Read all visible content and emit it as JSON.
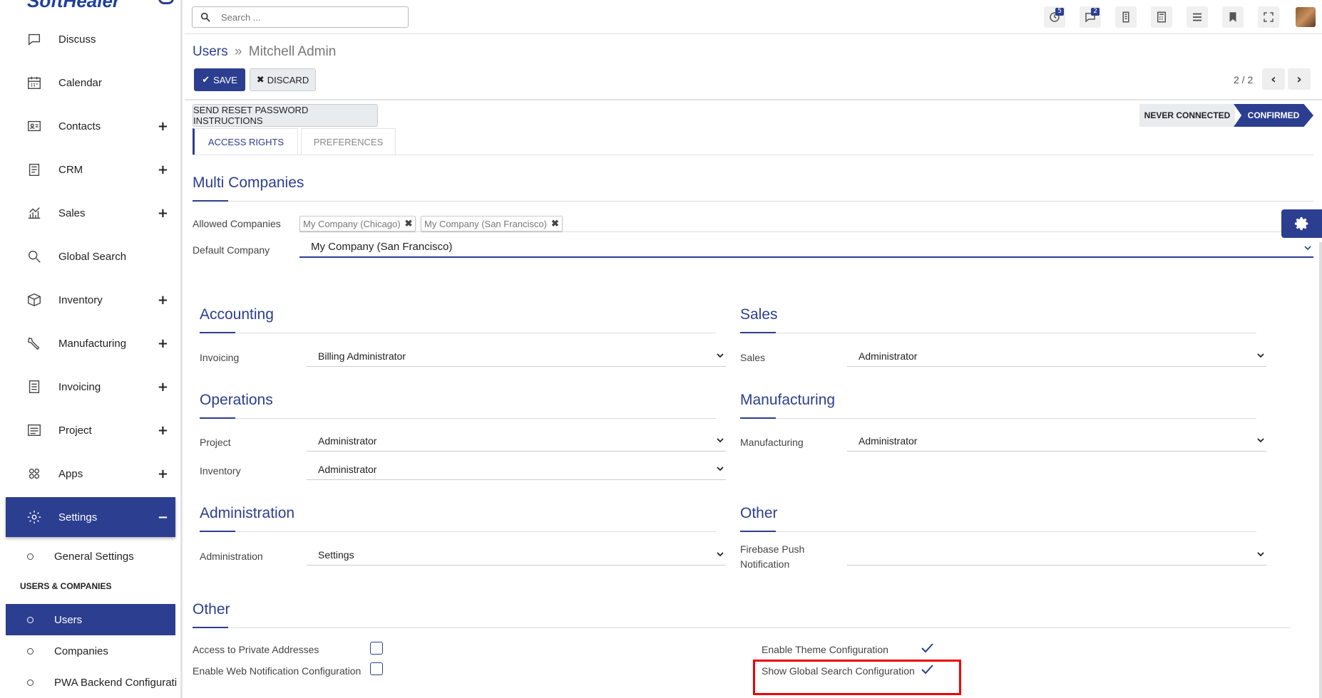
{
  "sidebar": {
    "logo": "SoftHealer",
    "items": [
      {
        "label": "Discuss",
        "icon": "chat-icon",
        "plus": ""
      },
      {
        "label": "Calendar",
        "icon": "calendar-icon",
        "plus": ""
      },
      {
        "label": "Contacts",
        "icon": "contact-card-icon",
        "plus": "+"
      },
      {
        "label": "CRM",
        "icon": "crm-icon",
        "plus": "+"
      },
      {
        "label": "Sales",
        "icon": "chart-icon",
        "plus": "+"
      },
      {
        "label": "Global Search",
        "icon": "search-icon",
        "plus": ""
      },
      {
        "label": "Inventory",
        "icon": "box-icon",
        "plus": "+"
      },
      {
        "label": "Manufacturing",
        "icon": "wrench-icon",
        "plus": "+"
      },
      {
        "label": "Invoicing",
        "icon": "invoice-icon",
        "plus": "+"
      },
      {
        "label": "Project",
        "icon": "project-icon",
        "plus": "+"
      },
      {
        "label": "Apps",
        "icon": "apps-icon",
        "plus": "+"
      },
      {
        "label": "Settings",
        "icon": "gear-icon",
        "plus": "−"
      }
    ],
    "sub_items": {
      "general_settings": "General Settings",
      "section_header": "USERS & COMPANIES",
      "users": "Users",
      "companies": "Companies",
      "pwa": "PWA Backend Configurati"
    }
  },
  "topbar": {
    "search_placeholder": "Search ...",
    "activity_badge": "5",
    "messages_badge": "2"
  },
  "control": {
    "breadcrumb_parent": "Users",
    "breadcrumb_sep": "»",
    "breadcrumb_current": "Mitchell Admin",
    "save_label": "SAVE",
    "discard_label": "DISCARD",
    "pager": "2 / 2"
  },
  "form": {
    "reset_password": "SEND RESET PASSWORD INSTRUCTIONS",
    "status_never": "NEVER CONNECTED",
    "status_confirmed": "CONFIRMED",
    "tab_access": "ACCESS RIGHTS",
    "tab_preferences": "PREFERENCES",
    "multi_companies": {
      "title": "Multi Companies",
      "allowed_label": "Allowed Companies",
      "allowed_tags": [
        "My Company (Chicago)",
        "My Company (San Francisco)"
      ],
      "default_label": "Default Company",
      "default_value": "My Company (San Francisco)"
    },
    "accounting": {
      "title": "Accounting",
      "invoicing_label": "Invoicing",
      "invoicing_value": "Billing Administrator"
    },
    "sales": {
      "title": "Sales",
      "sales_label": "Sales",
      "sales_value": "Administrator"
    },
    "operations": {
      "title": "Operations",
      "project_label": "Project",
      "project_value": "Administrator",
      "inventory_label": "Inventory",
      "inventory_value": "Administrator"
    },
    "manufacturing": {
      "title": "Manufacturing",
      "label": "Manufacturing",
      "value": "Administrator"
    },
    "administration": {
      "title": "Administration",
      "label": "Administration",
      "value": "Settings"
    },
    "other_right": {
      "title": "Other",
      "firebase_label_1": "Firebase Push",
      "firebase_label_2": "Notification",
      "firebase_value": ""
    },
    "other": {
      "title": "Other",
      "private_addresses": "Access to Private Addresses",
      "web_notification": "Enable Web Notification Configuration",
      "theme_config": "Enable Theme Configuration",
      "global_search_config": "Show Global Search Configuration"
    }
  },
  "colors": {
    "primary": "#2c3e8f",
    "highlight": "#e00000"
  }
}
